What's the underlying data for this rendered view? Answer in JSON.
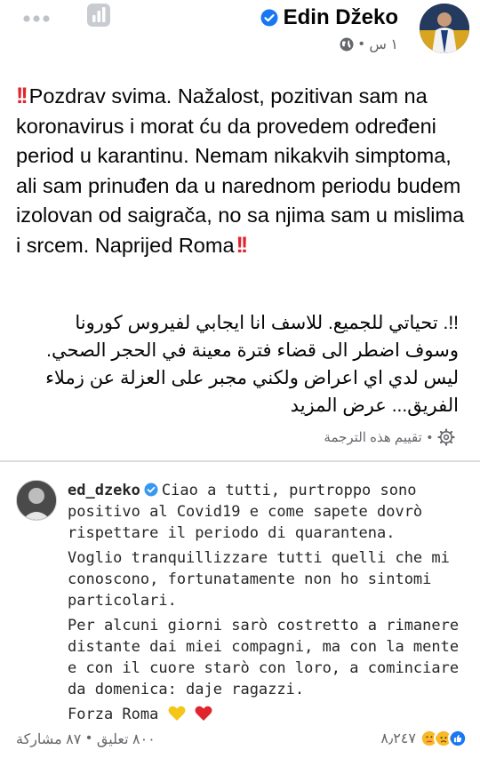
{
  "header": {
    "author_name": "Edin Džeko",
    "time": "١ س",
    "dot": "•"
  },
  "post": {
    "text": "Pozdrav svima. Nažalost, pozitivan sam na koronavirus i morat ću da provedem određeni period u karantinu. Nemam nikakvih simptoma, ali sam prinuđen da u narednom periodu budem izolovan od saigrača, no sa njima sam u mislima i srcem. Naprijed Roma",
    "emphasis": "!!"
  },
  "translation": {
    "text": "!!. تحياتي للجميع. للاسف انا ايجابي لفيروس كورونا وسوف اضطر الى قضاء فترة معينة في الحجر الصحي. ليس لدي اي اعراض ولكني مجبر على العزلة عن زملاء الفريق...",
    "see_more": "عرض المزيد",
    "rate_label": "تقييم هذه الترجمة",
    "dot": "•"
  },
  "instagram": {
    "username": "ed_dzeko",
    "line1": "Ciao a tutti, purtroppo sono positivo al Covid19 e come sapete dovrò rispettare il periodo di quarantena.",
    "line2": "Voglio tranquillizzare tutti quelli che mi conoscono, fortunatamente non ho sintomi particolari.",
    "line3": "Per alcuni giorni sarò costretto a rimanere distante dai miei compagni, ma con la mente e con il cuore starò con loro, a cominciare da domenica: daje ragazzi.",
    "line4": "Forza Roma",
    "hearts": [
      "yellow-heart",
      "red-heart"
    ]
  },
  "footer": {
    "reaction_count": "٨٫٢٤٧",
    "reactions": [
      "like",
      "sad",
      "care"
    ],
    "comments": "٨٠٠ تعليق",
    "dot": "•",
    "shares": "٨٧ مشاركة"
  },
  "colors": {
    "verified": "#1877f2",
    "secondary_text": "#65676b",
    "bangbang": "#e0252b",
    "like": "#1877f2",
    "yellow_heart": "#f5c518",
    "red_heart": "#e0252b"
  }
}
